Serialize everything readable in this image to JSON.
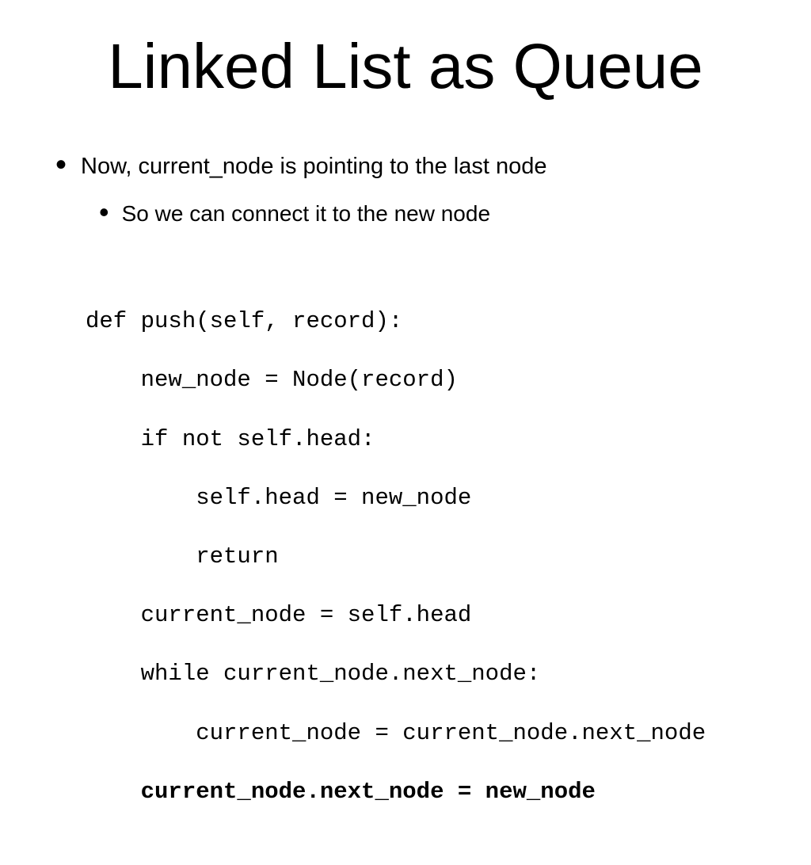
{
  "title": "Linked List as Queue",
  "bullet1": "Now, current_node is pointing to the last node",
  "bullet2": "So we can connect it to the new node",
  "code": {
    "l1": "def push(self, record):",
    "l2": "    new_node = Node(record)",
    "l3": "    if not self.head:",
    "l4": "        self.head = new_node",
    "l5": "        return",
    "l6": "    current_node = self.head",
    "l7": "    while current_node.next_node:",
    "l8": "        current_node = current_node.next_node",
    "l9": "    current_node.next_node = new_node"
  }
}
